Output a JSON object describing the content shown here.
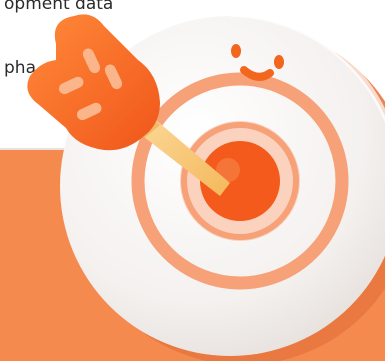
{
  "document": {
    "line_1": "opment data",
    "line_2": "pha"
  },
  "colors": {
    "panel": "#f58a4f",
    "target_face": "#f4f1ef",
    "ring": "#f6a177",
    "bullseye": "#f35a1b",
    "dart": "#f3661d",
    "shaft": "#f7c06a"
  },
  "illustration": {
    "subject": "smiling-target-with-dart-icon"
  }
}
